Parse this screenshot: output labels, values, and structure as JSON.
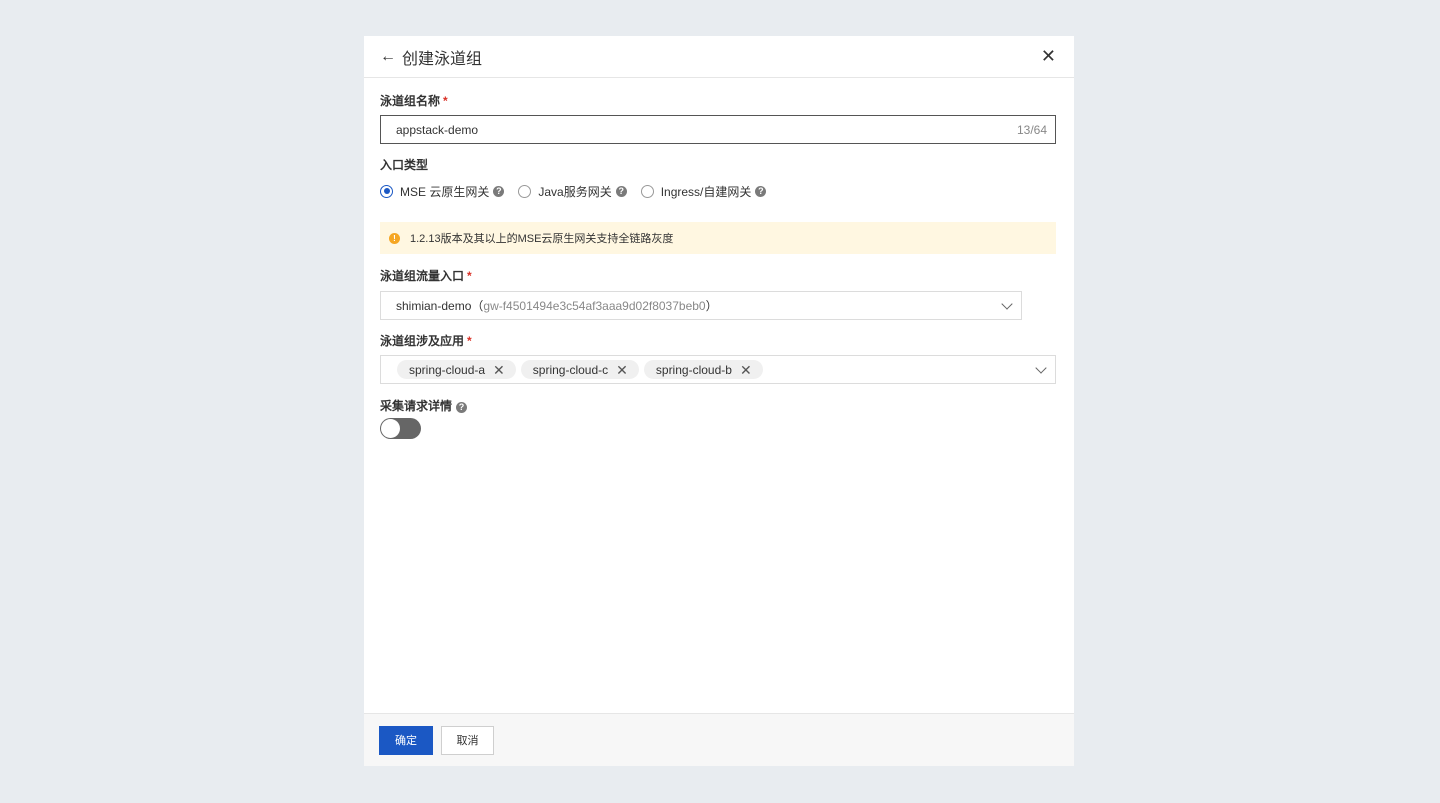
{
  "dialog": {
    "back_icon": "←",
    "title": "创建泳道组",
    "close_icon": "✕"
  },
  "form": {
    "name_label": "泳道组名称",
    "required_mark": "*",
    "name_value": "appstack-demo",
    "name_counter": "13/64",
    "entry_type_label": "入口类型",
    "entry_options": [
      {
        "label": "MSE 云原生网关",
        "checked": true
      },
      {
        "label": "Java服务网关",
        "checked": false
      },
      {
        "label": "Ingress/自建网关",
        "checked": false
      }
    ],
    "help_icon": "?",
    "alert_icon": "!",
    "alert_text": "1.2.13版本及其以上的MSE云原生网关支持全链路灰度",
    "traffic_entry_label": "泳道组流量入口",
    "traffic_entry_value": "shimian-demo",
    "traffic_entry_sub": "gw-f4501494e3c54af3aaa9d02f8037beb0",
    "traffic_entry_paren_open": "（",
    "traffic_entry_paren_close": "）",
    "apps_label": "泳道组涉及应用",
    "apps": [
      "spring-cloud-a",
      "spring-cloud-c",
      "spring-cloud-b"
    ],
    "tag_close_icon": "✕",
    "collect_label": "采集请求详情",
    "collect_enabled": false
  },
  "footer": {
    "confirm_label": "确定",
    "cancel_label": "取消"
  },
  "colors": {
    "primary": "#1b58c4",
    "required": "#d93026",
    "alert_bg": "#fff7e1",
    "warn": "#f5a623"
  }
}
